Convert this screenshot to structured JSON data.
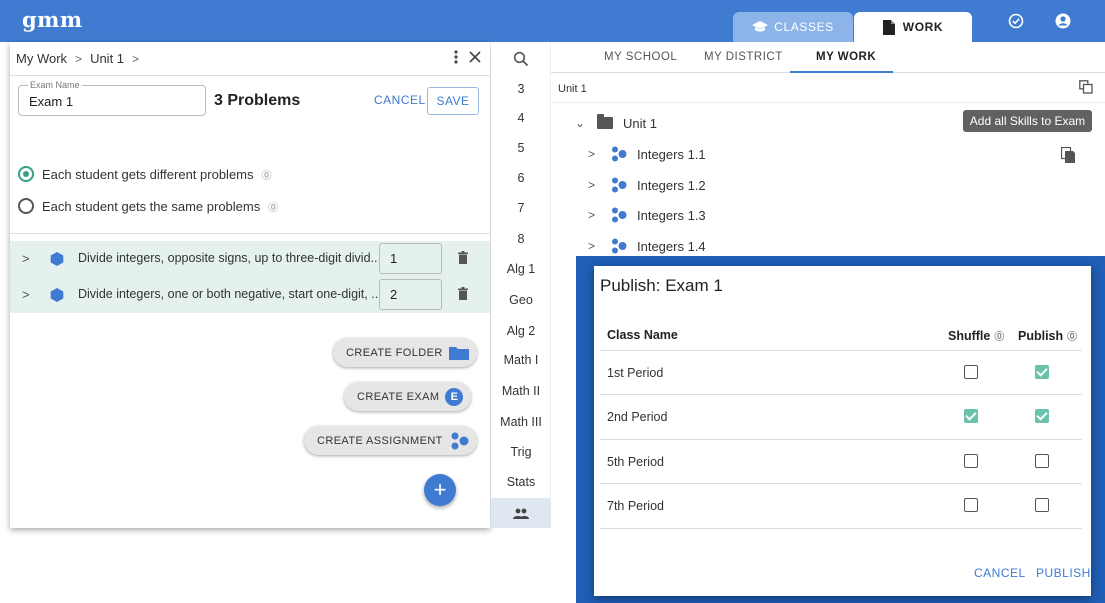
{
  "app": {
    "logo": "gmm"
  },
  "topnav": {
    "tabs": [
      {
        "label": "CLASSES",
        "icon": "graduation-cap-icon"
      },
      {
        "label": "WORK",
        "icon": "document-icon"
      }
    ],
    "icons": [
      "check-circle-icon",
      "account-icon"
    ]
  },
  "breadcrumb": {
    "items": [
      "My Work",
      "Unit 1"
    ],
    "separator": ">"
  },
  "exam": {
    "field_label": "Exam Name",
    "name": "Exam 1",
    "problem_count": "3 Problems",
    "cancel_label": "CANCEL",
    "save_label": "SAVE"
  },
  "options": {
    "different": "Each student gets different problems",
    "same": "Each student gets the same problems",
    "selected": "different"
  },
  "problems": [
    {
      "text": "Divide integers, opposite signs, up to three-digit divid...",
      "qty": "1"
    },
    {
      "text": "Divide integers, one or both negative, start one-digit, ...",
      "qty": "2"
    }
  ],
  "create_buttons": {
    "folder": "CREATE FOLDER",
    "exam": "CREATE EXAM",
    "exam_badge": "E",
    "assignment": "CREATE ASSIGNMENT",
    "fab": "+"
  },
  "grades": [
    "3",
    "4",
    "5",
    "6",
    "7",
    "8",
    "Alg 1",
    "Geo",
    "Alg 2",
    "Math I",
    "Math II",
    "Math III",
    "Trig",
    "Stats"
  ],
  "library": {
    "tabs": [
      "MY SCHOOL",
      "MY DISTRICT",
      "MY WORK"
    ],
    "active_tab": "MY WORK",
    "current": "Unit 1",
    "folder": "Unit 1",
    "skills": [
      "Integers 1.1",
      "Integers 1.2",
      "Integers 1.3",
      "Integers 1.4"
    ],
    "tooltip": "Add all Skills to Exam"
  },
  "publish_dialog": {
    "title": "Publish: Exam 1",
    "col_class": "Class Name",
    "col_shuffle": "Shuffle",
    "col_publish": "Publish",
    "rows": [
      {
        "name": "1st Period",
        "shuffle": false,
        "publish": true
      },
      {
        "name": "2nd Period",
        "shuffle": true,
        "publish": true
      },
      {
        "name": "5th Period",
        "shuffle": false,
        "publish": false
      },
      {
        "name": "7th Period",
        "shuffle": false,
        "publish": false
      }
    ],
    "cancel_label": "CANCEL",
    "publish_label": "PUBLISH"
  },
  "colors": {
    "primary": "#3f7bd0",
    "accent_teal": "#36a08a",
    "dialog_frame": "#1f5fb8"
  }
}
